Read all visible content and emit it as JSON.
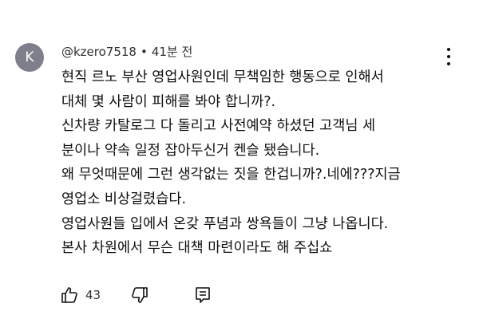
{
  "comment": {
    "avatar_letter": "K",
    "author": "@kzero7518",
    "separator": "•",
    "timestamp": "41분 전",
    "lines": [
      "현직 르노 부산 영업사원인데 무책임한 행동으로 인해서",
      "대체 몇 사람이 피해를 봐야 합니까?.",
      "신차량 카탈로그 다 돌리고  사전예약 하셨던 고객님 세",
      "분이나 약속 일정 잡아두신거 켄슬 됐습니다.",
      "왜 무엇때문에 그런 생각없는 짓을 한겁니까?.네에???지금",
      "영업소 비상걸렸습다.",
      "영업사원들 입에서 온갖 푸념과 쌍욕들이 그냥 나옵니다.",
      "본사 차원에서 무슨 대책 마련이라도 해 주십쇼"
    ],
    "like_count": "43"
  },
  "icons": {
    "avatar_bg": "#7e7f8a",
    "like": "thumbs-up-icon",
    "dislike": "thumbs-down-icon",
    "reply": "reply-comment-icon",
    "more": "more-vertical-icon"
  }
}
